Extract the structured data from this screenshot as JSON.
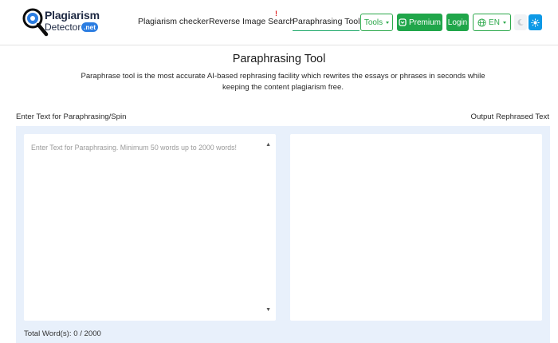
{
  "header": {
    "logo": {
      "line1": "Plagiarism",
      "line2": "Detector",
      "badge": ".net"
    },
    "nav": {
      "plagiarism_checker": "Plagiarism checker",
      "reverse_image_search": "Reverse Image Search",
      "new_marker": "!",
      "paraphrasing_tool": "Paraphrasing Tool"
    },
    "tools_label": "Tools",
    "premium_label": "Premium",
    "login_label": "Login",
    "language_label": "EN"
  },
  "main": {
    "title": "Paraphrasing Tool",
    "description": "Paraphrase tool is the most accurate AI-based rephrasing facility which rewrites the essays or phrases in seconds while keeping the content plagiarism free.",
    "input_label": "Enter Text for Paraphrasing/Spin",
    "output_label": "Output Rephrased Text",
    "input_placeholder": "Enter Text for Paraphrasing. Minimum 50 words up to 2000 words!",
    "word_count": "Total Word(s): 0 / 2000"
  },
  "colors": {
    "accent_green": "#20a64a",
    "theme_blue": "#0d99e6",
    "panel_bg": "#e8f0fb",
    "logo_blue": "#2b7de1"
  },
  "icons": [
    "magnifier-logo-icon",
    "caret-down-icon",
    "premium-icon",
    "globe-icon",
    "moon-icon",
    "sun-icon",
    "scroll-up-icon",
    "scroll-down-icon"
  ]
}
